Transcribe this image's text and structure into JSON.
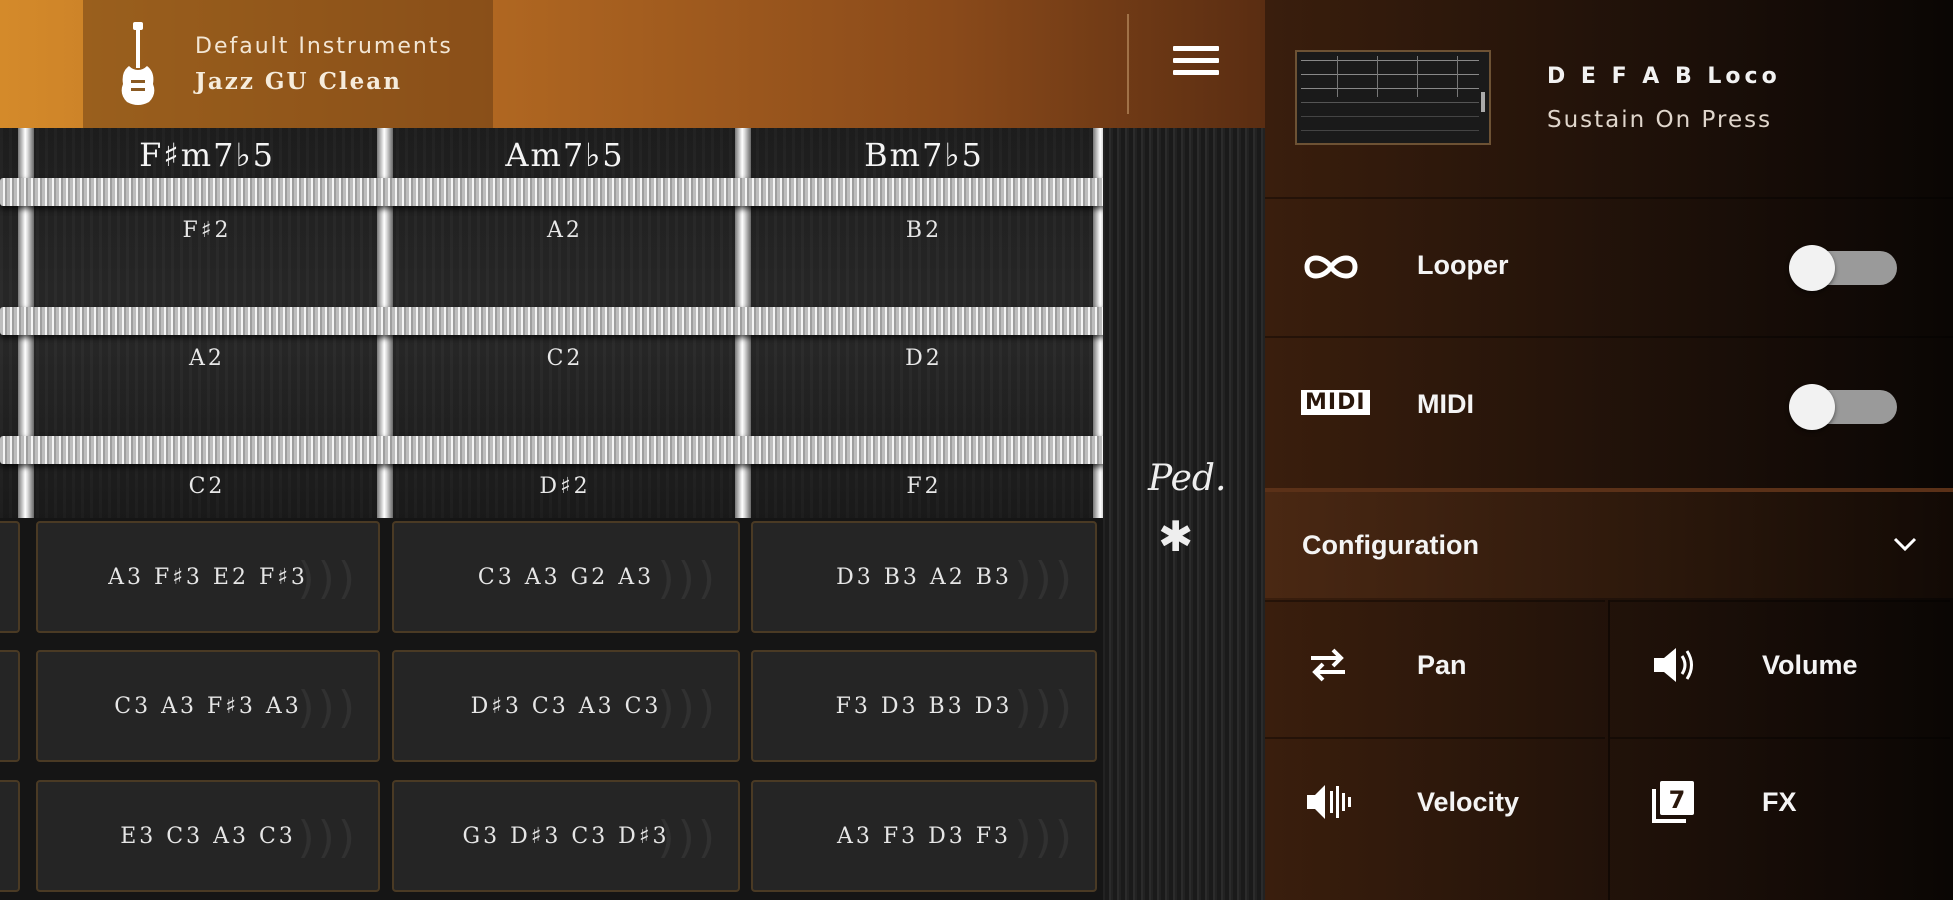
{
  "header": {
    "instrument_category": "Default Instruments",
    "instrument_name": "Jazz GU Clean"
  },
  "fretboard": {
    "chords": [
      "F♯m7♭5",
      "Am7♭5",
      "Bm7♭5"
    ],
    "notes_row1": [
      "F♯2",
      "A2",
      "B2"
    ],
    "notes_row2": [
      "A2",
      "C2",
      "D2"
    ],
    "notes_row3": [
      "C2",
      "D♯2",
      "F2"
    ]
  },
  "pads": {
    "row1": [
      "A3 F♯3 E2 F♯3",
      "C3 A3 G2 A3",
      "D3 B3 A2 B3"
    ],
    "row2": [
      "C3 A3 F♯3 A3",
      "D♯3 C3 A3 C3",
      "F3 D3 B3 D3"
    ],
    "row3": [
      "E3 C3 A3 C3",
      "G3 D♯3 C3 D♯3",
      "A3 F3 D3 F3"
    ]
  },
  "pedal": {
    "ped_label": "Ped.",
    "release_icon": "✱"
  },
  "panel": {
    "preset_name": "D E F A B Loco",
    "preset_mode": "Sustain On Press",
    "looper_label": "Looper",
    "looper_on": false,
    "midi_label": "MIDI",
    "midi_on": false,
    "midi_icon_text": "MIDI",
    "configuration_label": "Configuration",
    "pan_label": "Pan",
    "volume_label": "Volume",
    "velocity_label": "Velocity",
    "fx_label": "FX",
    "fx_icon_number": "7"
  },
  "colors": {
    "topbar_start": "#d48a2a",
    "topbar_end": "#5a2d12",
    "pad_border": "#4a3a24",
    "panel_bg": "#1f1109"
  }
}
